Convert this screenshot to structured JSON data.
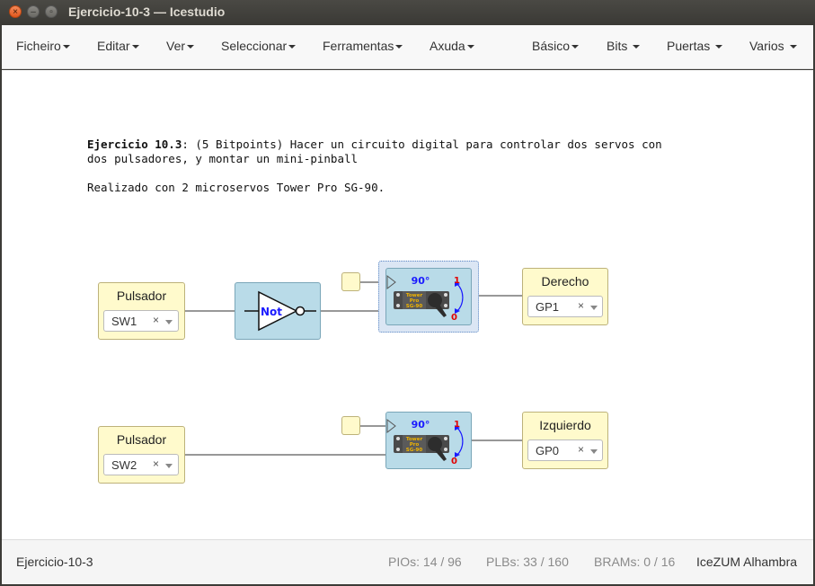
{
  "window": {
    "title": "Ejercicio-10-3 — Icestudio"
  },
  "menubar": {
    "left": [
      "Ficheiro",
      "Editar",
      "Ver",
      "Seleccionar",
      "Ferramentas",
      "Axuda"
    ],
    "right": [
      "Básico",
      "Bits",
      "Puertas",
      "Varios"
    ]
  },
  "note": {
    "bold": "Ejercicio 10.3",
    "line1": ": (5 Bitpoints) Hacer un circuito digital para controlar dos servos con",
    "line2": "dos pulsadores, y montar un mini-pinball",
    "line3": "Realizado con 2 microservos Tower Pro SG-90."
  },
  "blocks": {
    "input1": {
      "label": "Pulsador",
      "pin": "SW1"
    },
    "input2": {
      "label": "Pulsador",
      "pin": "SW2"
    },
    "output1": {
      "label": "Derecho",
      "pin": "GP1"
    },
    "output2": {
      "label": "Izquierdo",
      "pin": "GP0"
    },
    "not_gate": {
      "label": "Not"
    },
    "servo": {
      "angle": "90°",
      "mark_one": "1",
      "mark_zero": "0",
      "brand_lines": [
        "Tower",
        "Pro",
        "SG-90"
      ]
    },
    "clear_symbol": "×"
  },
  "statusbar": {
    "project": "Ejercicio-10-3",
    "pios_label": "PIOs:",
    "pios_value": "14 / 96",
    "plbs_label": "PLBs:",
    "plbs_value": "33 / 160",
    "brams_label": "BRAMs:",
    "brams_value": "0 / 16",
    "board": "IceZUM Alhambra"
  },
  "colors": {
    "io_block": "#fffacc",
    "logic_block": "#b9dbe8",
    "angle_text": "#1a1aff",
    "one_text": "#e00000"
  }
}
